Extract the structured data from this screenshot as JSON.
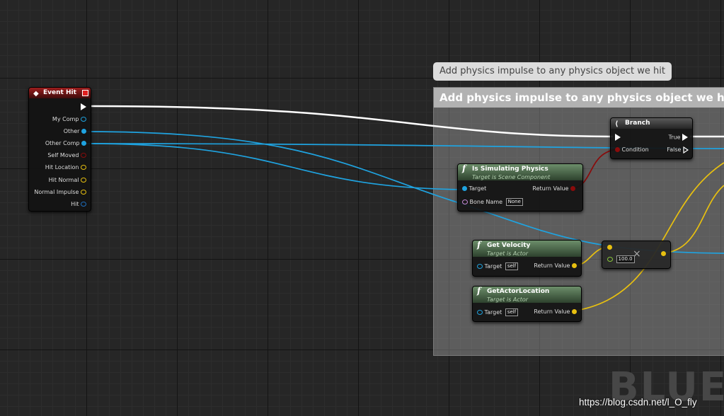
{
  "comment": {
    "bubble_text": "Add physics impulse to any physics object we hit",
    "title": "Add physics impulse to any physics object we hit"
  },
  "event_hit": {
    "title": "Event Hit",
    "icon": "event-diamond-icon",
    "pins": [
      {
        "label": "My Comp",
        "type": "object",
        "color": "#1fa3e0"
      },
      {
        "label": "Other",
        "type": "object",
        "color": "#1fa3e0"
      },
      {
        "label": "Other Comp",
        "type": "object",
        "color": "#1fa3e0"
      },
      {
        "label": "Self Moved",
        "type": "bool",
        "color": "#8a0b0b"
      },
      {
        "label": "Hit Location",
        "type": "vector",
        "color": "#e8c010"
      },
      {
        "label": "Hit Normal",
        "type": "vector",
        "color": "#e8c010"
      },
      {
        "label": "Normal Impulse",
        "type": "vector",
        "color": "#e8c010"
      },
      {
        "label": "Hit",
        "type": "struct",
        "color": "#1f6fc0"
      }
    ]
  },
  "branch": {
    "title": "Branch",
    "condition_label": "Condition",
    "true_label": "True",
    "false_label": "False"
  },
  "is_simulating": {
    "title": "Is Simulating Physics",
    "subtitle": "Target is Scene Component",
    "target_label": "Target",
    "return_label": "Return Value",
    "bone_label": "Bone Name",
    "bone_value": "None"
  },
  "get_velocity": {
    "title": "Get Velocity",
    "subtitle": "Target is Actor",
    "target_label": "Target",
    "target_value": "self",
    "return_label": "Return Value"
  },
  "get_actor_location": {
    "title": "GetActorLocation",
    "subtitle": "Target is Actor",
    "target_label": "Target",
    "target_value": "self",
    "return_label": "Return Value"
  },
  "multiply": {
    "operator": "×",
    "value": "100.0"
  },
  "colors": {
    "exec": "#ffffff",
    "object": "#1fa3e0",
    "bool": "#8a0b0b",
    "vector": "#e8c010",
    "name": "#c68ad8",
    "float": "#8ac83c"
  },
  "watermark": "BLUEP",
  "url": "https://blog.csdn.net/l_O_fly"
}
